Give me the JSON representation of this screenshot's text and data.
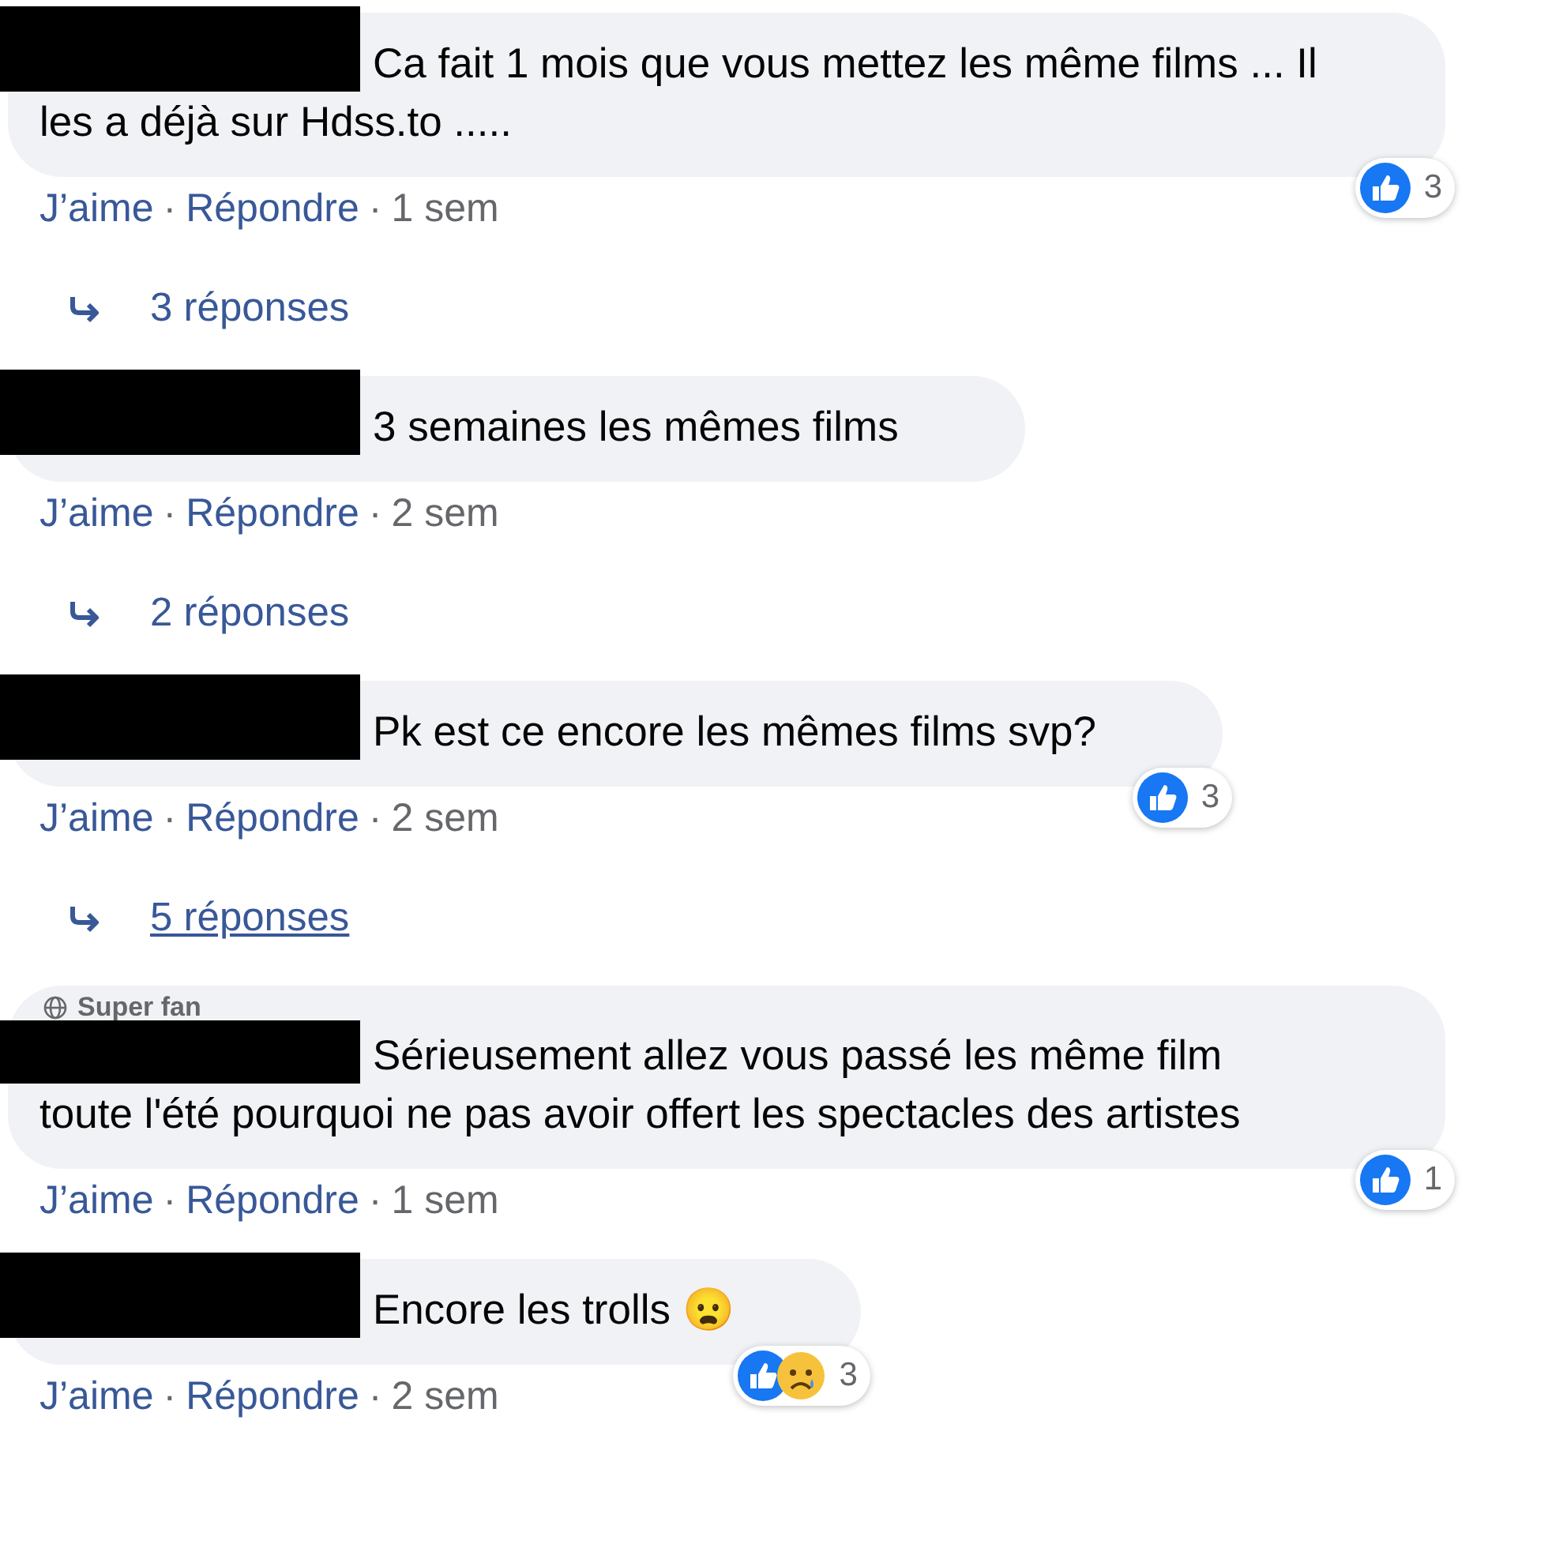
{
  "comments": [
    {
      "text": "Ca fait 1 mois que vous mettez les même films ... Il les a déjà sur Hdss.to .....",
      "redacted": true,
      "reactions": {
        "icons": [
          {
            "kind": "like"
          }
        ],
        "count": "3"
      },
      "actions": {
        "like": "J’aime",
        "sep1": "·",
        "reply": "Répondre",
        "sep2": "·",
        "time": "1 sem"
      },
      "replies": {
        "text": "3 réponses",
        "underlined": false
      }
    },
    {
      "text": "3 semaines les mêmes films",
      "redacted": true,
      "actions": {
        "like": "J’aime",
        "sep1": "·",
        "reply": "Répondre",
        "sep2": "·",
        "time": "2 sem"
      },
      "replies": {
        "text": "2 réponses",
        "underlined": false
      }
    },
    {
      "text": "Pk est ce encore les mêmes films svp?",
      "redacted": true,
      "reactions": {
        "icons": [
          {
            "kind": "like"
          }
        ],
        "count": "3"
      },
      "actions": {
        "like": "J’aime",
        "sep1": "·",
        "reply": "Répondre",
        "sep2": "·",
        "time": "2 sem"
      },
      "replies": {
        "text": "5 réponses",
        "underlined": true
      }
    },
    {
      "badge": "Super fan",
      "text": "Sérieusement allez vous passé les même film toute l'été pourquoi ne pas avoir offert les spectacles des artistes",
      "redacted": true,
      "reactions": {
        "icons": [
          {
            "kind": "like"
          }
        ],
        "count": "1"
      },
      "actions": {
        "like": "J’aime",
        "sep1": "·",
        "reply": "Répondre",
        "sep2": "·",
        "time": "1 sem"
      }
    },
    {
      "text": "Encore les trolls 😦",
      "redacted": true,
      "reactions": {
        "icons": [
          {
            "kind": "like"
          },
          {
            "kind": "sad"
          }
        ],
        "count": "3"
      },
      "actions": {
        "like": "J’aime",
        "sep1": "·",
        "reply": "Répondre",
        "sep2": "·",
        "time": "2 sem"
      }
    }
  ]
}
